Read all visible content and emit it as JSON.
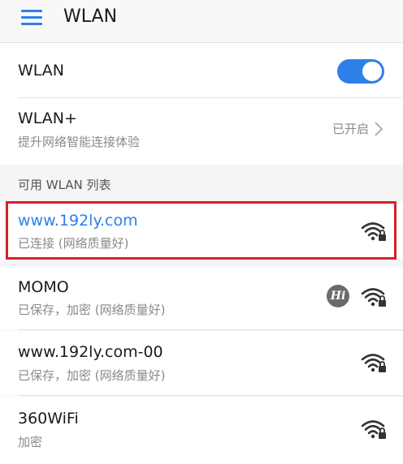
{
  "appbar": {
    "title": "WLAN"
  },
  "wlan_toggle": {
    "label": "WLAN",
    "enabled": true,
    "accent_color": "#2f7fe8"
  },
  "wlan_plus": {
    "label": "WLAN+",
    "description": "提升网络智能连接体验",
    "status": "已开启"
  },
  "available_list": {
    "header": "可用 WLAN 列表",
    "networks": [
      {
        "name": "www.192ly.com",
        "status": "已连接 (网络质量好)",
        "connected": true,
        "secured": true,
        "highlighted": true,
        "icon": "wifi-lock-icon"
      },
      {
        "name": "MOMO",
        "status": "已保存，加密 (网络质量好)",
        "connected": false,
        "secured": true,
        "hilink": true,
        "icon": "wifi-lock-icon"
      },
      {
        "name": "www.192ly.com-00",
        "status": "已保存，加密 (网络质量好)",
        "connected": false,
        "secured": true,
        "icon": "wifi-lock-icon"
      },
      {
        "name": "360WiFi",
        "status": "加密",
        "connected": false,
        "secured": true,
        "icon": "wifi-lock-icon"
      }
    ]
  },
  "colors": {
    "accent": "#2f7fe8",
    "highlight_border": "#d6202c"
  }
}
